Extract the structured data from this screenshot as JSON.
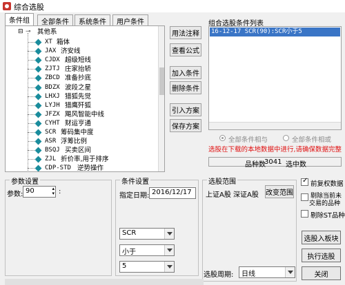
{
  "window": {
    "title": "综合选股"
  },
  "tabs": [
    "条件组",
    "全部条件",
    "系统条件",
    "用户条件"
  ],
  "tree": {
    "root_label": "其他系",
    "items": [
      {
        "code": "XT",
        "name": "箱体"
      },
      {
        "code": "JAX",
        "name": "济安线"
      },
      {
        "code": "CJDX",
        "name": "超级短线"
      },
      {
        "code": "ZJTJ",
        "name": "庄家抬轿"
      },
      {
        "code": "ZBCD",
        "name": "准备抄底"
      },
      {
        "code": "BDZX",
        "name": "波段之星"
      },
      {
        "code": "LHXJ",
        "name": "猎狐先觉"
      },
      {
        "code": "LYJH",
        "name": "猎鹰歼狐"
      },
      {
        "code": "JFZX",
        "name": "飓风智能中线"
      },
      {
        "code": "CYHT",
        "name": "财运亨通"
      },
      {
        "code": "SCR",
        "name": "筹码集中度"
      },
      {
        "code": "ASR",
        "name": "浮筹比例"
      },
      {
        "code": "BSQJ",
        "name": "买卖区间"
      },
      {
        "code": "ZJL",
        "name": "折价率,用于排序"
      },
      {
        "code": "CDP-STD",
        "name": "逆势操作"
      }
    ]
  },
  "buttons": {
    "usage_note": "用法注释",
    "view_formula": "查看公式",
    "add_condition": "加入条件",
    "delete_condition": "删除条件",
    "import_scheme": "引入方案",
    "save_scheme": "保存方案",
    "change_range": "改变范围",
    "select_to_board": "选股入板块",
    "execute": "执行选股",
    "close": "关闭"
  },
  "combined_list": {
    "label": "组合选股条件列表",
    "items": [
      "16-12-17 SCR(90):SCR小于5"
    ]
  },
  "logic": {
    "and_label": "全部条件相与",
    "or_label": "全部条件相或"
  },
  "warning": "选股在下载的本地数据中进行,请确保数据完整",
  "status": {
    "count_label": "品种数",
    "count_value": "3041",
    "selected_label": "选中数",
    "selected_value": ""
  },
  "params": {
    "group_title": "参数设置",
    "param_label": "参数:",
    "param_value": "90",
    "param_suffix": ":"
  },
  "condition": {
    "group_title": "条件设置",
    "date_label": "指定日期:",
    "date_value": "2016/12/17",
    "indicator": "SCR",
    "operator": "小于",
    "value": "5"
  },
  "range": {
    "group_title": "选股范围",
    "markets": "上证A股 深证A股"
  },
  "options": {
    "restore_data": "前复权数据",
    "exclude_untraded_1": "剔除当前未",
    "exclude_untraded_2": "交易的品种",
    "exclude_st": "剔除ST品种"
  },
  "period": {
    "label": "选股周期:",
    "value": "日线"
  }
}
